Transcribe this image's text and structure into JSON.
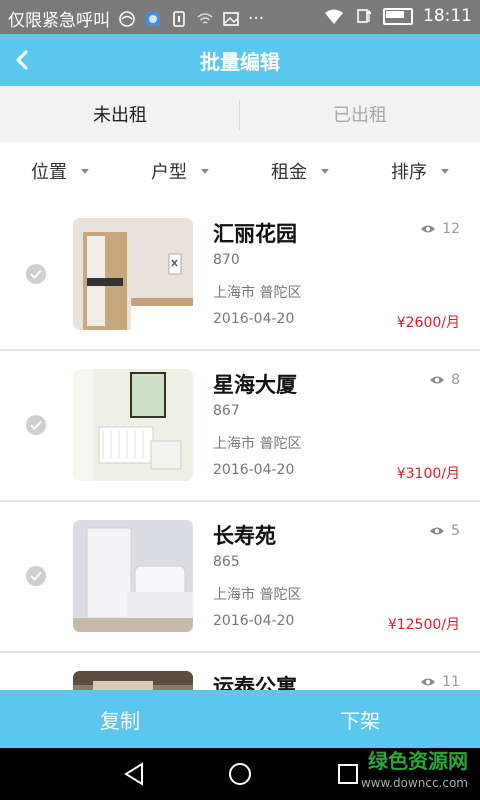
{
  "status_bar": {
    "carrier_text": "仅限紧急呼叫",
    "more": "···",
    "time": "18:11",
    "icons": [
      "sim-icon",
      "weather-icon",
      "sim-card-icon",
      "wifi-off-icon",
      "image-icon",
      "wifi-icon",
      "data-icon",
      "battery-icon"
    ]
  },
  "header": {
    "title": "批量编辑",
    "back_icon": "chevron-left-icon"
  },
  "tabs": [
    {
      "label": "未出租",
      "active": true
    },
    {
      "label": "已出租",
      "active": false
    }
  ],
  "filters": [
    {
      "label": "位置"
    },
    {
      "label": "户型"
    },
    {
      "label": "租金"
    },
    {
      "label": "排序"
    }
  ],
  "listings": [
    {
      "name": "汇丽花园",
      "code": "870",
      "location": "上海市 普陀区",
      "date": "2016-04-20",
      "views": "12",
      "price": "¥2600/月"
    },
    {
      "name": "星海大厦",
      "code": "867",
      "location": "上海市 普陀区",
      "date": "2016-04-20",
      "views": "8",
      "price": "¥3100/月"
    },
    {
      "name": "长寿苑",
      "code": "865",
      "location": "上海市 普陀区",
      "date": "2016-04-20",
      "views": "5",
      "price": "¥12500/月"
    },
    {
      "name": "运泰公寓",
      "code": "",
      "location": "",
      "date": "",
      "views": "11",
      "price": ""
    }
  ],
  "bottom_bar": {
    "copy_label": "复制",
    "offline_label": "下架"
  },
  "watermark": {
    "text": "绿色资源网",
    "url": "www.downcc.com"
  },
  "colors": {
    "accent": "#5bc6ee",
    "price": "#d8212c",
    "watermark": "#29a838"
  }
}
